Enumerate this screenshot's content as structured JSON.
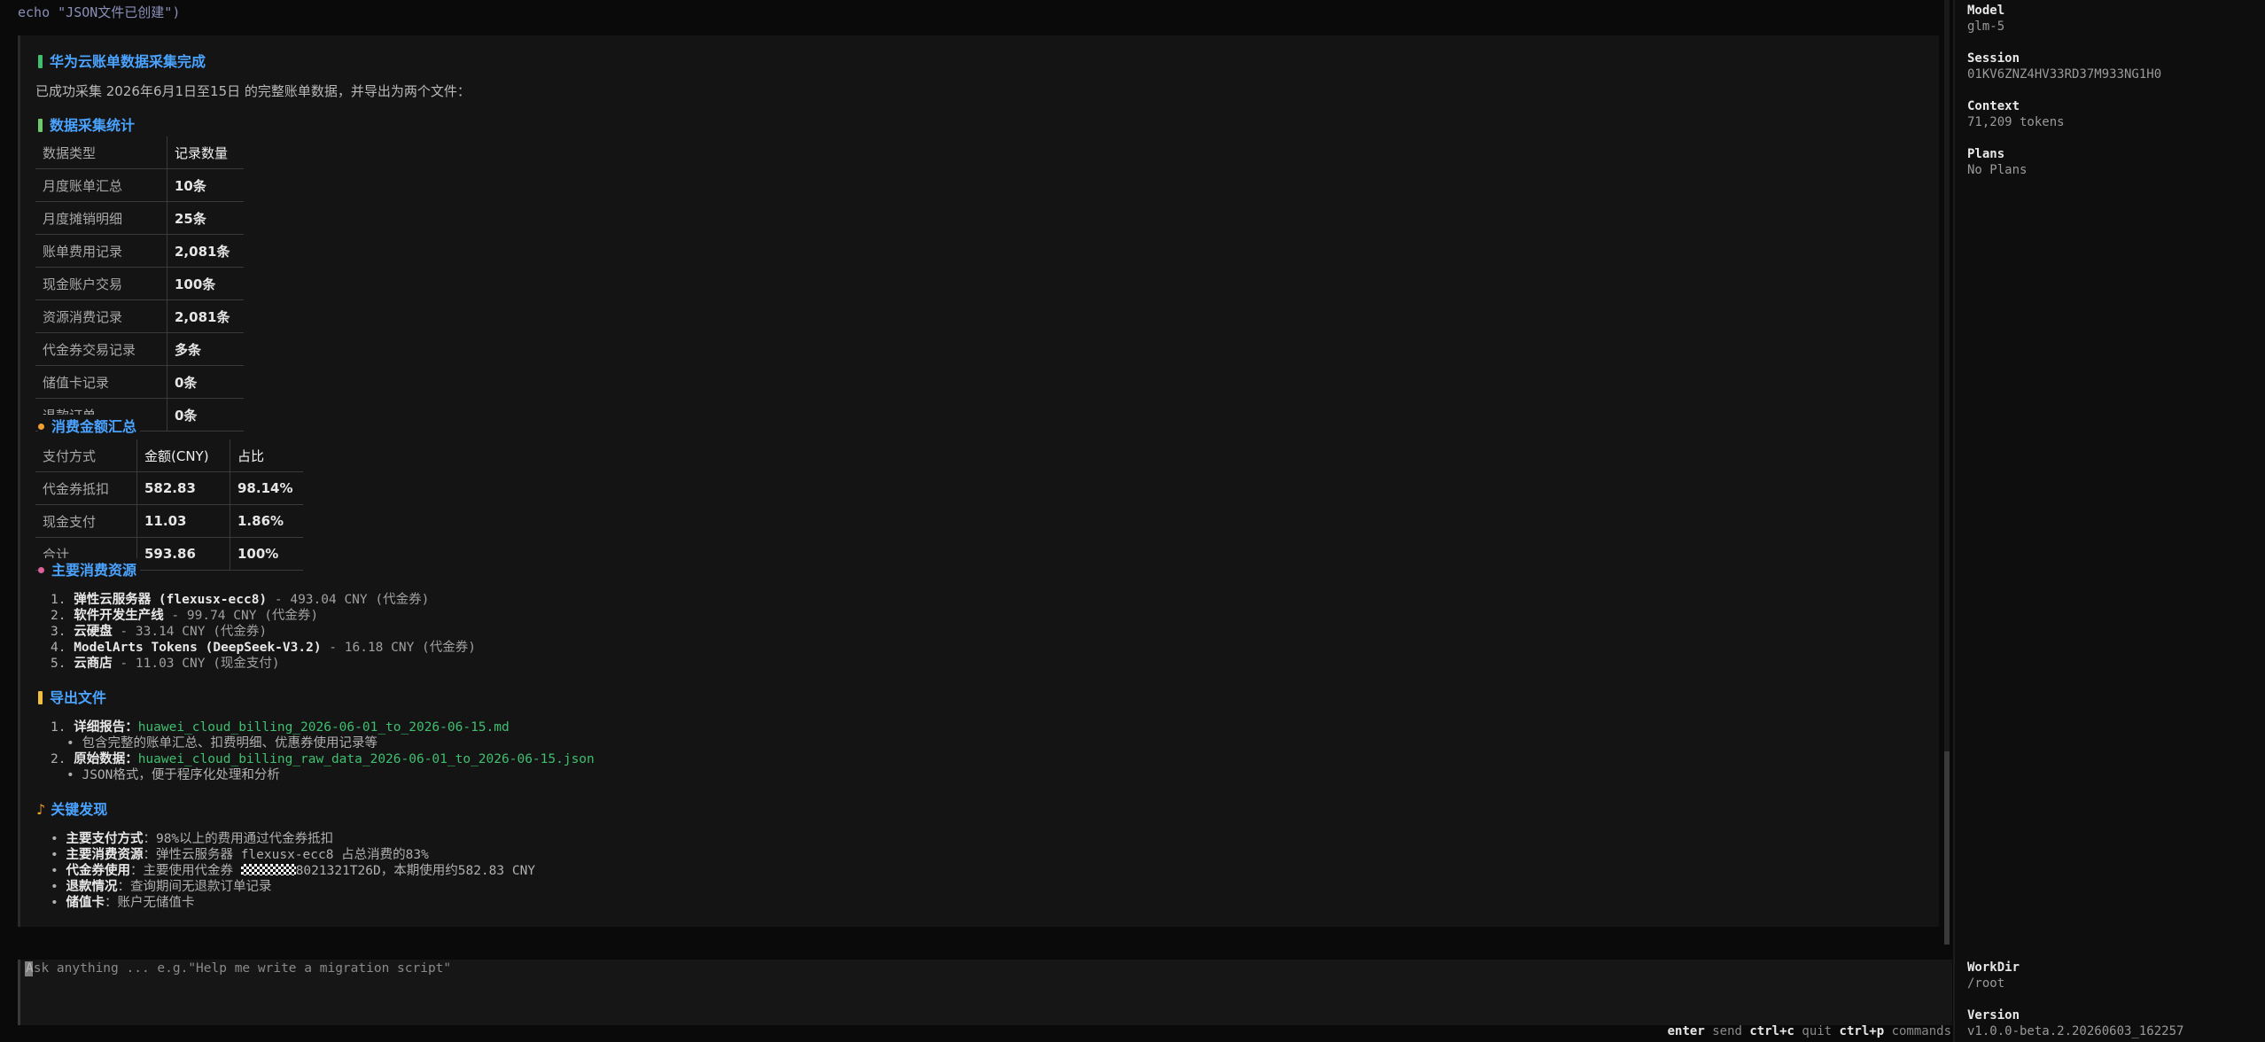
{
  "transcript": {
    "echo_line": "echo \"JSON文件已创建\")"
  },
  "message": {
    "title": "华为云账单数据采集完成",
    "intro": "已成功采集 2026年6月1日至15日 的完整账单数据，并导出为两个文件：",
    "stats": {
      "heading": "数据采集统计",
      "col_type": "数据类型",
      "col_count": "记录数量",
      "rows": [
        {
          "type": "月度账单汇总",
          "count": "10条"
        },
        {
          "type": "月度摊销明细",
          "count": "25条"
        },
        {
          "type": "账单费用记录",
          "count": "2,081条"
        },
        {
          "type": "现金账户交易",
          "count": "100条"
        },
        {
          "type": "资源消费记录",
          "count": "2,081条"
        },
        {
          "type": "代金券交易记录",
          "count": "多条"
        },
        {
          "type": "储值卡记录",
          "count": "0条"
        },
        {
          "type": "退款订单",
          "count": "0条"
        }
      ]
    },
    "spend": {
      "heading": "消费金额汇总",
      "col_method": "支付方式",
      "col_amount": "金额(CNY)",
      "col_share": "占比",
      "rows": [
        {
          "method": "代金券抵扣",
          "amount": "582.83",
          "share": "98.14%"
        },
        {
          "method": "现金支付",
          "amount": "11.03",
          "share": "1.86%"
        },
        {
          "method": "合计",
          "amount": "593.86",
          "share": "100%"
        }
      ]
    },
    "resources": {
      "heading": "主要消费资源",
      "items": [
        {
          "num": "1.",
          "name": "弹性云服务器 (flexusx-ecc8)",
          "detail": " - 493.04 CNY (代金券)"
        },
        {
          "num": "2.",
          "name": "软件开发生产线",
          "detail": " - 99.74 CNY (代金券)"
        },
        {
          "num": "3.",
          "name": "云硬盘",
          "detail": " - 33.14 CNY (代金券)"
        },
        {
          "num": "4.",
          "name": "ModelArts Tokens (DeepSeek-V3.2)",
          "detail": " - 16.18 CNY (代金券)"
        },
        {
          "num": "5.",
          "name": "云商店",
          "detail": " - 11.03 CNY (现金支付)"
        }
      ]
    },
    "exports": {
      "heading": "导出文件",
      "items": [
        {
          "num": "1.",
          "label": "详细报告：",
          "file": "huawei_cloud_billing_2026-06-01_to_2026-06-15.md",
          "note": "包含完整的账单汇总、扣费明细、优惠券使用记录等"
        },
        {
          "num": "2.",
          "label": "原始数据：",
          "file": "huawei_cloud_billing_raw_data_2026-06-01_to_2026-06-15.json",
          "note": "JSON格式，便于程序化处理和分析"
        }
      ]
    },
    "findings": {
      "heading": "关键发现",
      "items": [
        {
          "label": "主要支付方式",
          "text": "：98%以上的费用通过代金券抵扣"
        },
        {
          "label": "主要消费资源",
          "text": "：弹性云服务器 flexusx-ecc8 占总消费的83%"
        },
        {
          "label": "代金券使用",
          "text_pre": "：主要使用代金券 ",
          "text_post": "8021321T26D，本期使用约582.83 CNY"
        },
        {
          "label": "退款情况",
          "text": "：查询期间无退款订单记录"
        },
        {
          "label": "储值卡",
          "text": "：账户无储值卡"
        }
      ]
    }
  },
  "input": {
    "placeholder": "Ask anything ... e.g.\"Help me write a migration script\""
  },
  "hints": {
    "enter_key": "enter",
    "enter_label": "send",
    "quit_key": "ctrl+c",
    "quit_label": "quit",
    "cmd_key": "ctrl+p",
    "cmd_label": "commands"
  },
  "sidebar": {
    "model_label": "Model",
    "model_value": "glm-5",
    "session_label": "Session",
    "session_value": "01KV6ZNZ4HV33RD37M933NG1H0",
    "context_label": "Context",
    "context_value": "71,209 tokens",
    "plans_label": "Plans",
    "plans_value": "No Plans",
    "workdir_label": "WorkDir",
    "workdir_value": "/root",
    "version_label": "Version",
    "version_value": "v1.0.0-beta.2.20260603_162257"
  },
  "colors": {
    "accent_blue": "#4aa3ff",
    "link_green": "#3fbf6f",
    "title_bar": "#3fbf6f",
    "stats_bar": "#6fc96f",
    "spend_dot": "#f0a030",
    "resources_dot": "#e0609a",
    "exports_bar": "#f0c040",
    "findings_glyph": "#f0a030"
  }
}
